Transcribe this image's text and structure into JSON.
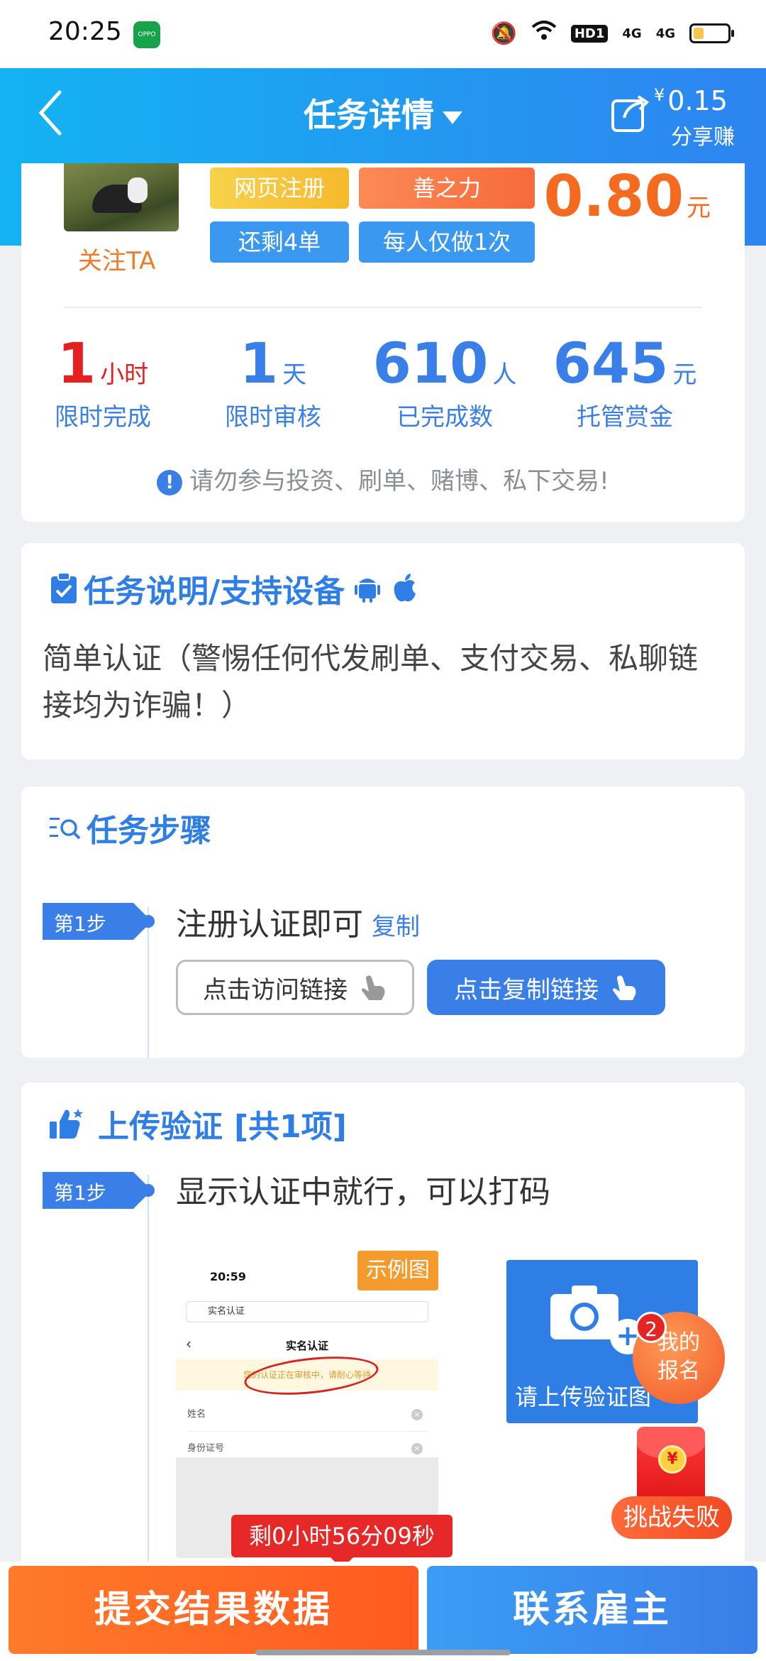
{
  "status_bar": {
    "time": "20:25",
    "app_icon": "OPPO",
    "hd": "HD1",
    "sig1": "4G",
    "sig2": "4G",
    "battery_level": 0.3
  },
  "header": {
    "title": "任务详情",
    "share_currency": "¥",
    "share_amount": "0.15",
    "share_label": "分享赚",
    "colors": {
      "from": "#13b3f2",
      "to": "#2e84f0"
    }
  },
  "task": {
    "follow_label": "关注TA",
    "tags": [
      "网页注册",
      "善之力",
      "还剩4单",
      "每人仅做1次"
    ],
    "price": "0.80",
    "price_unit": "元",
    "stats": [
      {
        "value": "1",
        "unit": "小时",
        "label": "限时完成"
      },
      {
        "value": "1",
        "unit": "天",
        "label": "限时审核"
      },
      {
        "value": "610",
        "unit": "人",
        "label": "已完成数"
      },
      {
        "value": "645",
        "unit": "元",
        "label": "托管赏金"
      }
    ],
    "warning": "请勿参与投资、刷单、赌博、私下交易!"
  },
  "description": {
    "title": "任务说明/支持设备",
    "text": "简单认证（警惕任何代发刷单、支付交易、私聊链接均为诈骗！）"
  },
  "steps": {
    "title": "任务步骤",
    "step_label": "第1步",
    "step_text": "注册认证即可",
    "copy_label": "复制",
    "visit_button": "点击访问链接",
    "copy_button": "点击复制链接"
  },
  "upload": {
    "title": "上传验证",
    "count_label": "[共1项]",
    "step_label": "第1步",
    "step_text": "显示认证中就行，可以打码",
    "example_tag": "示例图",
    "example": {
      "time": "20:59",
      "url_text": "实名认证",
      "nav_title": "实名认证",
      "notice": "您的认证正在审核中，请耐心等待",
      "row1": "姓名",
      "row2": "身份证号"
    },
    "upload_label": "请上传验证图"
  },
  "floating": {
    "signup_label_1": "我的",
    "signup_label_2": "报名",
    "signup_badge": "2",
    "challenge_label": "挑战失败"
  },
  "bottom": {
    "countdown": "剩0小时56分09秒",
    "submit_button": "提交结果数据",
    "contact_button": "联系雇主"
  }
}
